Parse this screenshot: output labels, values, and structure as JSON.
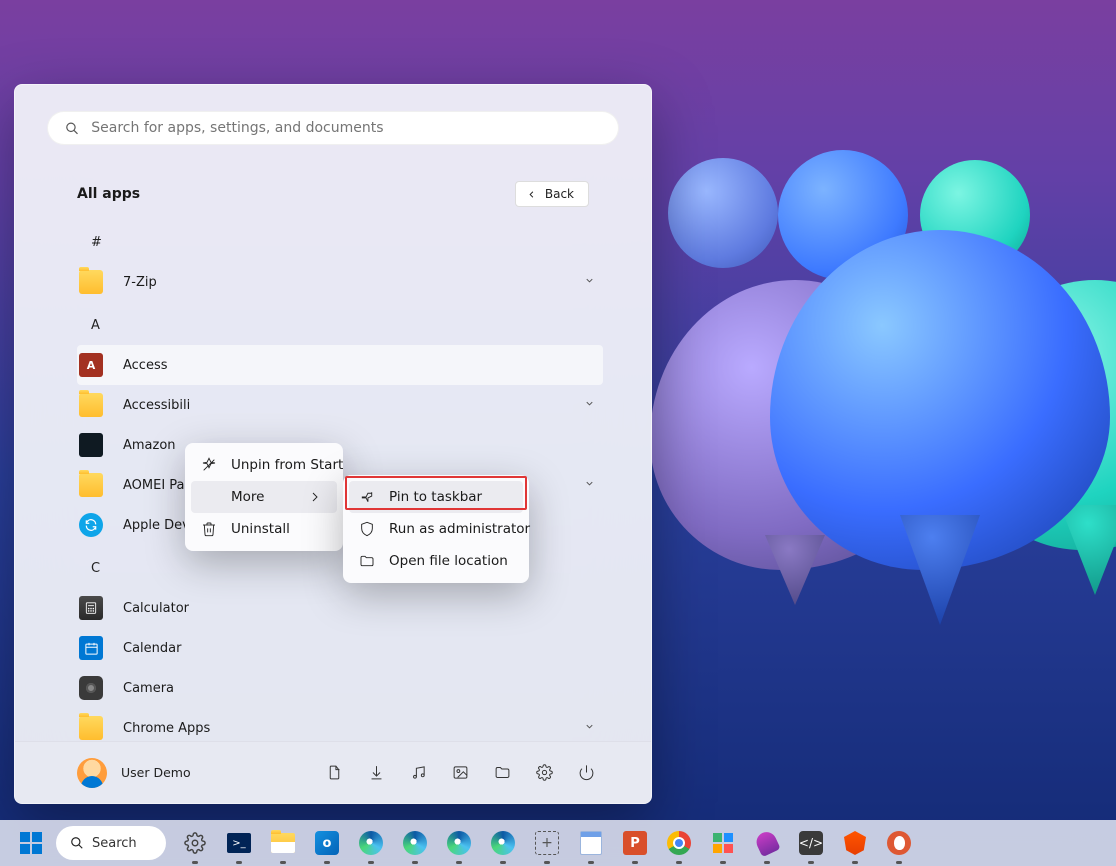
{
  "search": {
    "placeholder": "Search for apps, settings, and documents"
  },
  "header": {
    "title": "All apps",
    "back": "Back"
  },
  "sections": {
    "hash": "#",
    "a": "A",
    "c": "C"
  },
  "apps": {
    "seven_zip": "7-Zip",
    "access": "Access",
    "accessibility": "Accessibili",
    "amazon": "Amazon",
    "aomei": "AOMEI Partition Assistant",
    "apple": "Apple Devices",
    "calculator": "Calculator",
    "calendar": "Calendar",
    "camera": "Camera",
    "chrome_apps": "Chrome Apps"
  },
  "context1": {
    "unpin": "Unpin from Start",
    "more": "More",
    "uninstall": "Uninstall"
  },
  "context2": {
    "pin_taskbar": "Pin to taskbar",
    "run_admin": "Run as administrator",
    "open_loc": "Open file location"
  },
  "footer": {
    "user": "User Demo"
  },
  "taskbar": {
    "search": "Search"
  }
}
